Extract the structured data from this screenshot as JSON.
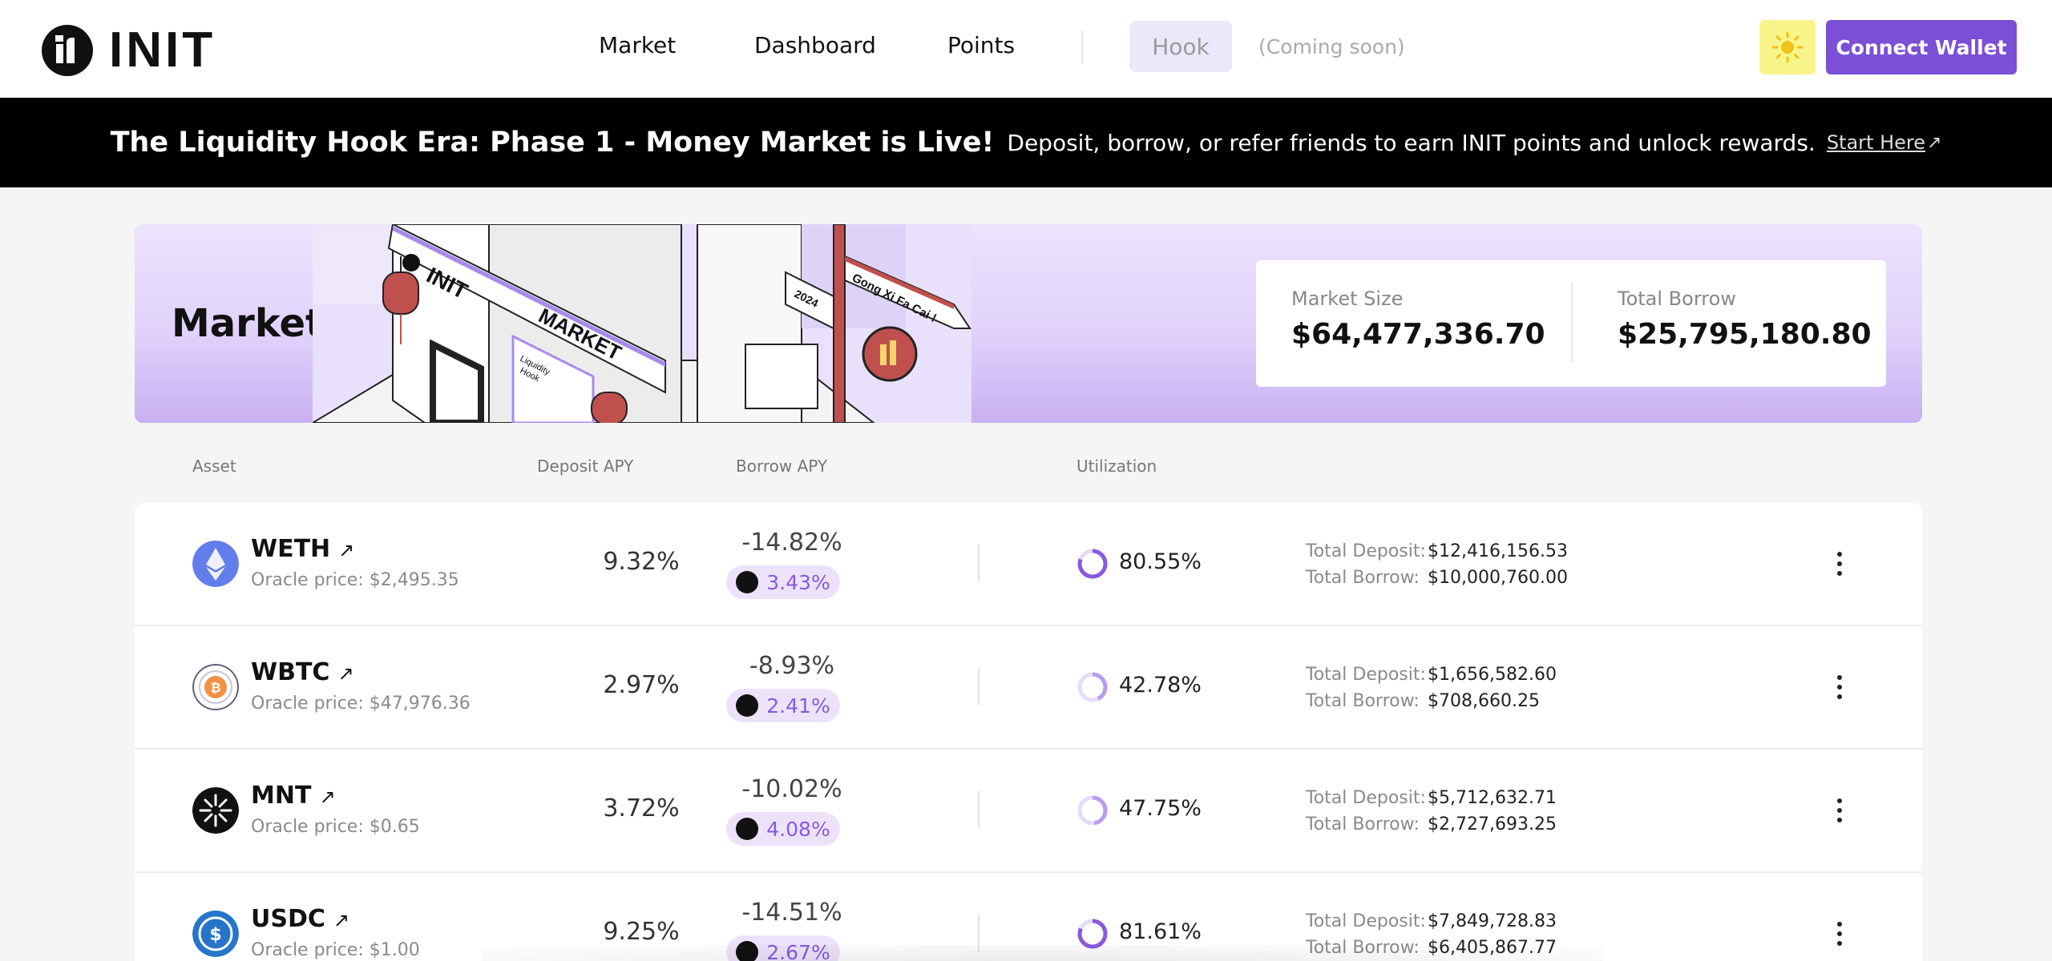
{
  "header": {
    "logo_text": "INIT",
    "nav": [
      {
        "label": "Market",
        "active": true
      },
      {
        "label": "Dashboard",
        "active": false
      },
      {
        "label": "Points",
        "active": false
      }
    ],
    "hook_label": "Hook",
    "coming_soon": "(Coming soon)",
    "connect_wallet": "Connect Wallet"
  },
  "banner": {
    "title": "The Liquidity Hook Era: Phase 1 - Money Market is Live!",
    "text": "Deposit, borrow, or refer friends to earn INIT points and unlock rewards.",
    "link": "Start Here"
  },
  "hero": {
    "title": "Market",
    "art_signs": {
      "init": "INIT",
      "market": "MARKET",
      "liquidity": "Liquidity",
      "hook": "Hook",
      "year": "2024",
      "greeting": "Gong Xi Fa Cai !"
    },
    "market_size_label": "Market Size",
    "market_size_value": "$64,477,336.70",
    "total_borrow_label": "Total Borrow",
    "total_borrow_value": "$25,795,180.80"
  },
  "table": {
    "headers": {
      "asset": "Asset",
      "deposit_apy": "Deposit APY",
      "borrow_apy": "Borrow APY",
      "utilization": "Utilization"
    },
    "total_deposit_label": "Total Deposit:",
    "total_borrow_label": "Total Borrow:",
    "rows": [
      {
        "name": "WETH",
        "oracle": "Oracle price: $2,495.35",
        "deposit_apy": "9.32%",
        "borrow_apy": "-14.82%",
        "borrow_reward": "3.43%",
        "utilization": "80.55%",
        "utilization_fraction": 0.8055,
        "total_deposit": "$12,416,156.53",
        "total_borrow": "$10,000,760.00",
        "icon": "weth-icon",
        "color": "#627eea"
      },
      {
        "name": "WBTC",
        "oracle": "Oracle price: $47,976.36",
        "deposit_apy": "2.97%",
        "borrow_apy": "-8.93%",
        "borrow_reward": "2.41%",
        "utilization": "42.78%",
        "utilization_fraction": 0.4278,
        "total_deposit": "$1,656,582.60",
        "total_borrow": "$708,660.25",
        "icon": "wbtc-icon",
        "color": "#f09242"
      },
      {
        "name": "MNT",
        "oracle": "Oracle price: $0.65",
        "deposit_apy": "3.72%",
        "borrow_apy": "-10.02%",
        "borrow_reward": "4.08%",
        "utilization": "47.75%",
        "utilization_fraction": 0.4775,
        "total_deposit": "$5,712,632.71",
        "total_borrow": "$2,727,693.25",
        "icon": "mnt-icon",
        "color": "#000000"
      },
      {
        "name": "USDC",
        "oracle": "Oracle price: $1.00",
        "deposit_apy": "9.25%",
        "borrow_apy": "-14.51%",
        "borrow_reward": "2.67%",
        "utilization": "81.61%",
        "utilization_fraction": 0.8161,
        "total_deposit": "$7,849,728.83",
        "total_borrow": "$6,405,867.77",
        "icon": "usdc-icon",
        "color": "#2775ca"
      }
    ]
  },
  "colors": {
    "accent": "#7b4fd6",
    "pill_bg": "#ece3fb",
    "pill_text": "#8b58e0"
  }
}
